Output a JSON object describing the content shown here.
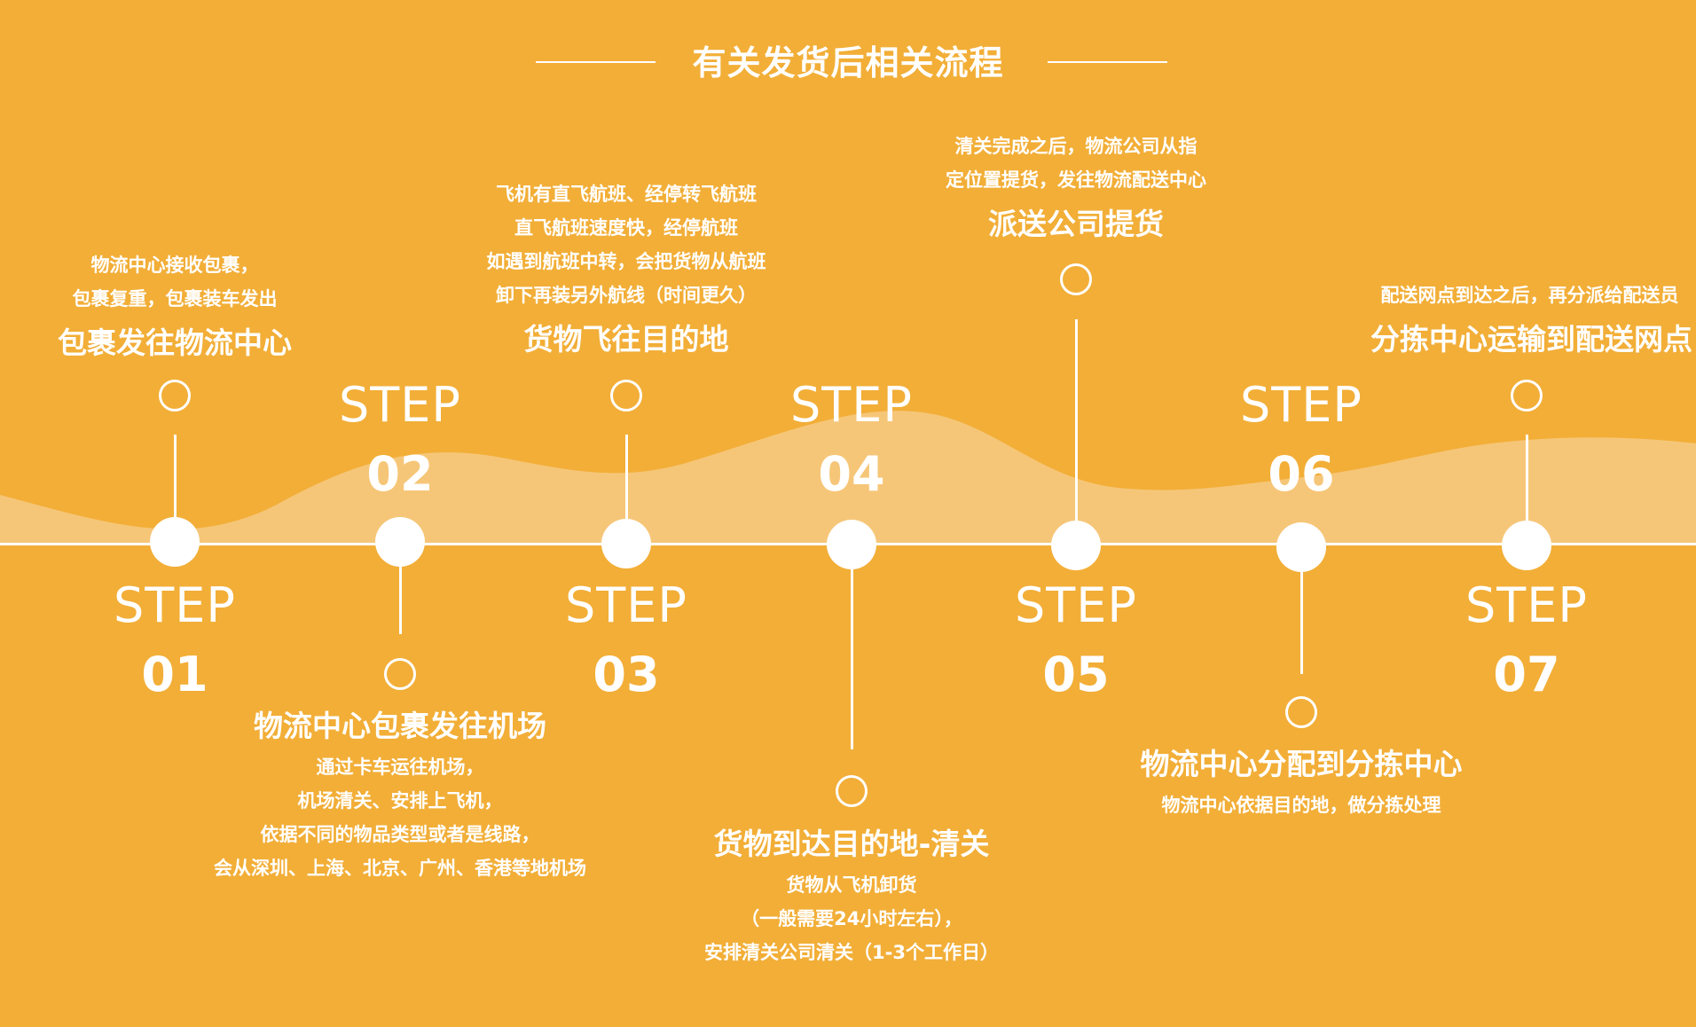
{
  "title": "有关发货后相关流程",
  "colors": {
    "background": "#F2AE37",
    "foreground": "#FFFFFF",
    "wave": "#F6C678"
  },
  "steps": [
    {
      "word": "STEP",
      "number": "01",
      "heading": "包裹发往物流中心",
      "desc": [
        "物流中心接收包裹，",
        "包裹复重，包裹装车发出"
      ]
    },
    {
      "word": "STEP",
      "number": "02",
      "heading": "物流中心包裹发往机场",
      "desc": [
        "通过卡车运往机场，",
        "机场清关、安排上飞机，",
        "依据不同的物品类型或者是线路，",
        "会从深圳、上海、北京、广州、香港等地机场"
      ]
    },
    {
      "word": "STEP",
      "number": "03",
      "heading": "货物飞往目的地",
      "desc": [
        "飞机有直飞航班、经停转飞航班",
        "直飞航班速度快，经停航班",
        "如遇到航班中转，会把货物从航班",
        "卸下再装另外航线（时间更久）"
      ]
    },
    {
      "word": "STEP",
      "number": "04",
      "heading": "货物到达目的地-清关",
      "desc": [
        "货物从飞机卸货",
        "（一般需要24小时左右），",
        "安排清关公司清关（1-3个工作日）"
      ]
    },
    {
      "word": "STEP",
      "number": "05",
      "heading": "派送公司提货",
      "desc": [
        "清关完成之后，物流公司从指",
        "定位置提货，发往物流配送中心"
      ]
    },
    {
      "word": "STEP",
      "number": "06",
      "heading": "物流中心分配到分拣中心",
      "desc": [
        "物流中心依据目的地，做分拣处理"
      ]
    },
    {
      "word": "STEP",
      "number": "07",
      "heading": "分拣中心运输到配送网点",
      "desc": [
        "配送网点到达之后，再分派给配送员"
      ]
    }
  ]
}
